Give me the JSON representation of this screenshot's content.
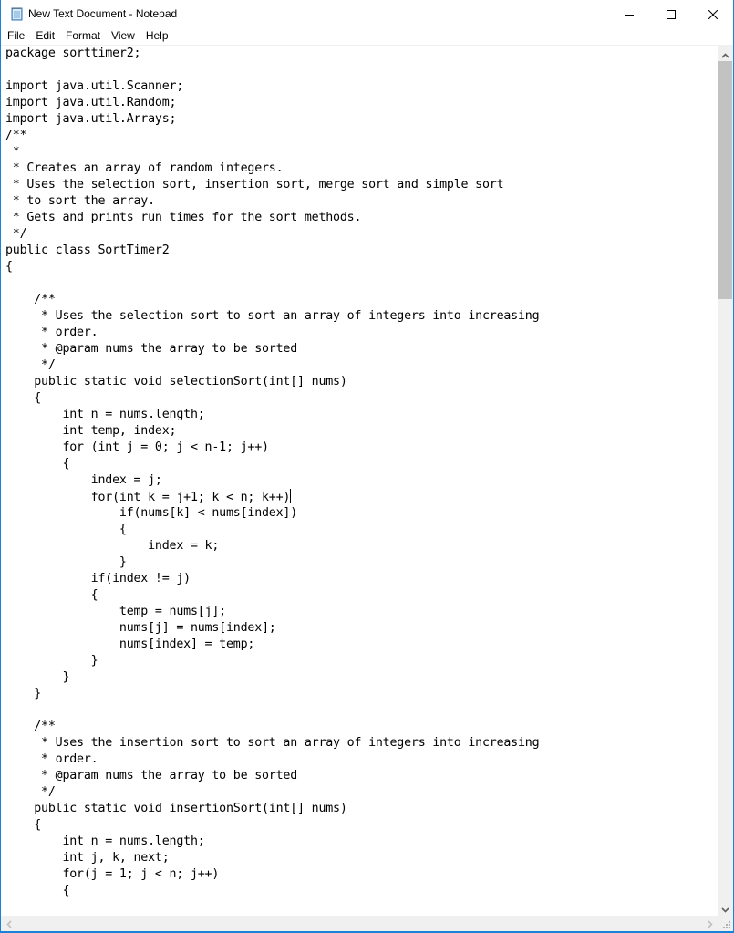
{
  "window": {
    "title": "New Text Document - Notepad",
    "app_icon": "notepad-icon",
    "controls": {
      "minimize": "minimize-icon",
      "maximize": "maximize-icon",
      "close": "close-icon"
    }
  },
  "menubar": {
    "items": [
      {
        "label": "File"
      },
      {
        "label": "Edit"
      },
      {
        "label": "Format"
      },
      {
        "label": "View"
      },
      {
        "label": "Help"
      }
    ]
  },
  "editor": {
    "caret_line": 27,
    "lines": [
      "package sorttimer2;",
      "",
      "import java.util.Scanner;",
      "import java.util.Random;",
      "import java.util.Arrays;",
      "/**",
      " *",
      " * Creates an array of random integers.",
      " * Uses the selection sort, insertion sort, merge sort and simple sort",
      " * to sort the array.",
      " * Gets and prints run times for the sort methods.",
      " */",
      "public class SortTimer2",
      "{",
      "",
      "    /**",
      "     * Uses the selection sort to sort an array of integers into increasing",
      "     * order.",
      "     * @param nums the array to be sorted",
      "     */",
      "    public static void selectionSort(int[] nums)",
      "    {",
      "        int n = nums.length;",
      "        int temp, index;",
      "        for (int j = 0; j < n-1; j++)",
      "        {",
      "            index = j;",
      "            for(int k = j+1; k < n; k++)",
      "                if(nums[k] < nums[index])",
      "                {",
      "                    index = k;",
      "                }",
      "            if(index != j)",
      "            {",
      "                temp = nums[j];",
      "                nums[j] = nums[index];",
      "                nums[index] = temp;",
      "            }",
      "        }",
      "    }",
      "",
      "    /**",
      "     * Uses the insertion sort to sort an array of integers into increasing",
      "     * order.",
      "     * @param nums the array to be sorted",
      "     */",
      "    public static void insertionSort(int[] nums)",
      "    {",
      "        int n = nums.length;",
      "        int j, k, next;",
      "        for(j = 1; j < n; j++)",
      "        {"
    ]
  },
  "scrollbars": {
    "vertical_position_fraction": 0.0,
    "vertical_visible_fraction": 0.28
  }
}
